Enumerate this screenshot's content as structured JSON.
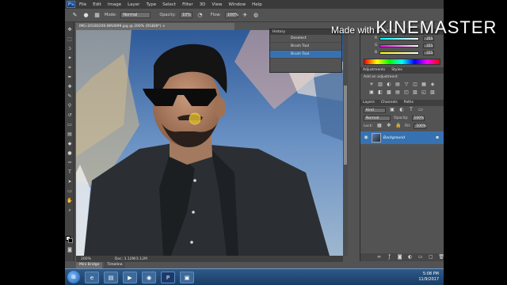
{
  "menu": {
    "logo": "Ps",
    "items": [
      "File",
      "Edit",
      "Image",
      "Layer",
      "Type",
      "Select",
      "Filter",
      "3D",
      "View",
      "Window",
      "Help"
    ]
  },
  "options": {
    "mode_label": "Mode:",
    "mode_value": "Normal",
    "opacity_label": "Opacity:",
    "opacity_value": "10%",
    "flow_label": "Flow:",
    "flow_value": "100%"
  },
  "document": {
    "tab_title": "IMG-20180206-WA0099.jpg @ 200% (RGB/8*) ×",
    "zoom": "200%",
    "doc_size": "Doc: 3.12M/3.12M"
  },
  "history": {
    "title": "History",
    "items": [
      {
        "label": "Deselect",
        "selected": false
      },
      {
        "label": "Brush Tool",
        "selected": false
      },
      {
        "label": "Brush Tool",
        "selected": true
      }
    ]
  },
  "color_panel": {
    "tabs": [
      "Color",
      "Swatches"
    ],
    "sliders": [
      {
        "channel": "R",
        "value": "255",
        "gradient": "#ff0000"
      },
      {
        "channel": "G",
        "value": "255",
        "gradient": "#00ff00"
      },
      {
        "channel": "B",
        "value": "255",
        "gradient": "#0000ff"
      }
    ]
  },
  "adjustments": {
    "tabs": [
      "Adjustments",
      "Styles"
    ],
    "title": "Add an adjustment",
    "icons": [
      "☀",
      "▥",
      "◐",
      "▤",
      "▽",
      "◫",
      "▦",
      "◈",
      "▣",
      "◧",
      "▩",
      "▤",
      "◰",
      "▨",
      "◱",
      "▧"
    ]
  },
  "layers": {
    "tabs": [
      "Layers",
      "Channels",
      "Paths"
    ],
    "kind_label": "Kind",
    "blend_mode": "Normal",
    "opacity_label": "Opacity:",
    "opacity_value": "100%",
    "lock_label": "Lock:",
    "fill_label": "Fill:",
    "fill_value": "100%",
    "layer_name": "Background"
  },
  "bottom_tabs": [
    "Mini Bridge",
    "Timeline"
  ],
  "taskbar": {
    "time": "5:08 PM",
    "date": "11/9/2017"
  },
  "watermark": {
    "small": "Made with",
    "big": "KINEMASTER"
  },
  "colors": {
    "highlight": "#3672b2",
    "panel_bg": "#535353",
    "menubar": "#3a3a3a"
  }
}
